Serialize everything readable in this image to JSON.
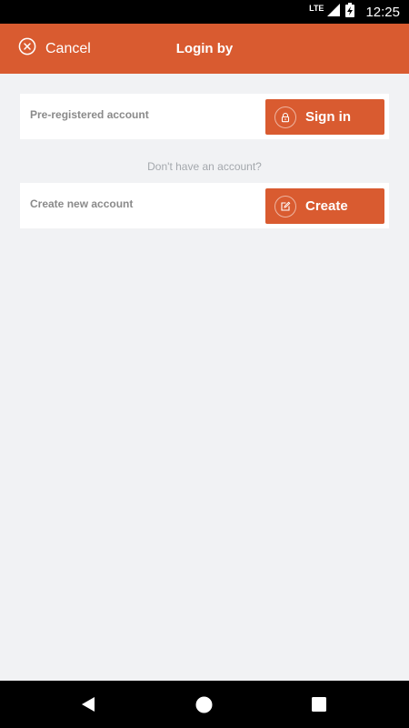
{
  "status_bar": {
    "network": "LTE",
    "time": "12:25"
  },
  "app_bar": {
    "cancel_label": "Cancel",
    "title": "Login by"
  },
  "accounts": [
    {
      "label": "Pre-registered account",
      "button_label": "Sign in",
      "button_icon": "lock-icon"
    },
    {
      "label": "Create new account",
      "button_label": "Create",
      "button_icon": "edit-icon"
    }
  ],
  "hint": "Don't have an account?",
  "colors": {
    "accent": "#d95b30",
    "background": "#f1f2f4",
    "card": "#ffffff",
    "label_text": "#8a8a8a",
    "hint_text": "#a4a8ad"
  },
  "nav_bar": {
    "icons": [
      "back-icon",
      "home-icon",
      "recents-icon"
    ]
  }
}
